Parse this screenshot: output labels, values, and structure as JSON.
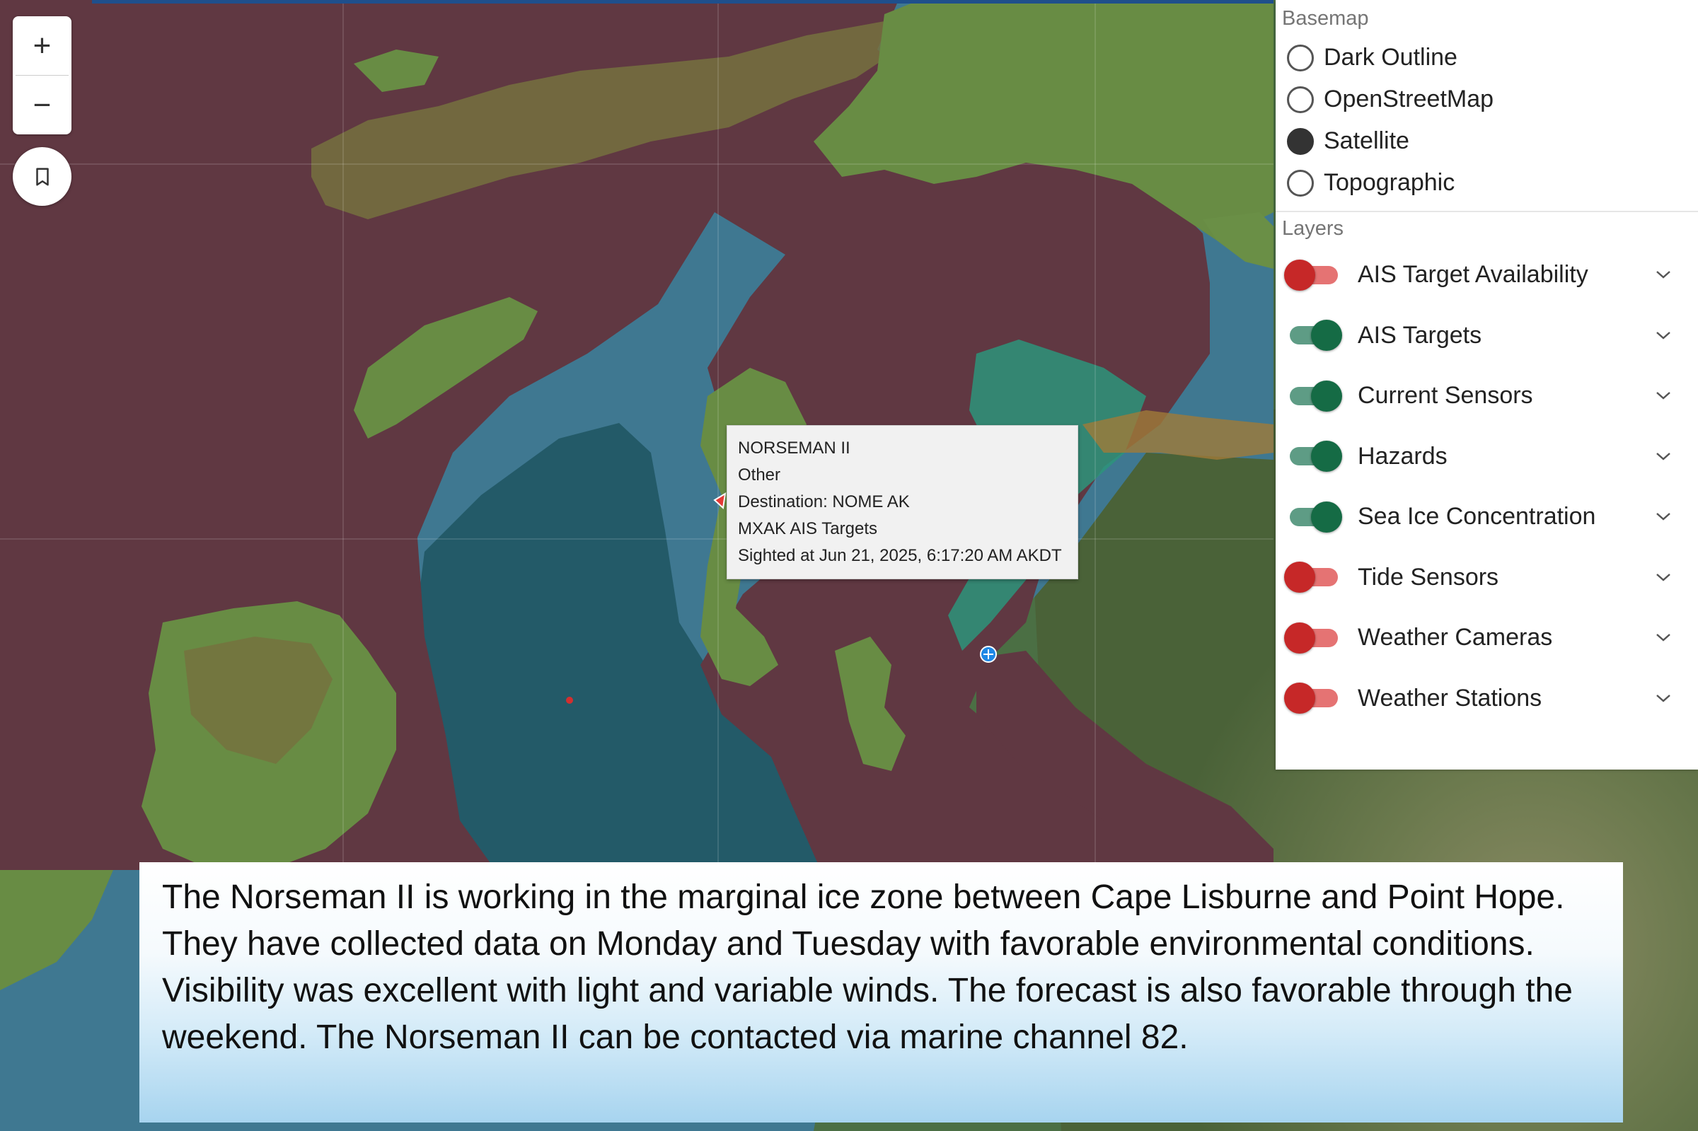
{
  "map": {
    "zoom_in_label": "+",
    "zoom_out_label": "−",
    "colors": {
      "land": "#4b6f44",
      "land_right": "#6f7648",
      "water": "#3f7891",
      "deep_water": "#235a68",
      "red_zone": "#603842",
      "green_zone": "#688c44",
      "olive_zone": "#76713e",
      "teal_zone": "#2d947a",
      "orange_zone": "#a07a38"
    }
  },
  "basemap": {
    "title": "Basemap",
    "options": [
      {
        "label": "Dark Outline",
        "selected": false
      },
      {
        "label": "OpenStreetMap",
        "selected": false
      },
      {
        "label": "Satellite",
        "selected": true
      },
      {
        "label": "Topographic",
        "selected": false
      }
    ]
  },
  "layers": {
    "title": "Layers",
    "items": [
      {
        "label": "AIS Target Availability",
        "enabled": false
      },
      {
        "label": "AIS Targets",
        "enabled": true
      },
      {
        "label": "Current Sensors",
        "enabled": true
      },
      {
        "label": "Hazards",
        "enabled": true
      },
      {
        "label": "Sea Ice Concentration",
        "enabled": true
      },
      {
        "label": "Tide Sensors",
        "enabled": false
      },
      {
        "label": "Weather Cameras",
        "enabled": false
      },
      {
        "label": "Weather Stations",
        "enabled": false
      }
    ]
  },
  "popup": {
    "vessel_name": "NORSEMAN II",
    "type": "Other",
    "destination": "Destination: NOME AK",
    "source": "MXAK AIS Targets",
    "sighted": "Sighted at Jun 21, 2025, 6:17:20 AM AKDT"
  },
  "caption": {
    "text": "The Norseman II is working in the marginal ice zone between Cape Lisburne and Point Hope. They have collected data on Monday and Tuesday with favorable environmental conditions. Visibility was excellent with light and variable winds. The forecast is also favorable through the weekend. The Norseman II can be contacted via  marine channel 82."
  }
}
